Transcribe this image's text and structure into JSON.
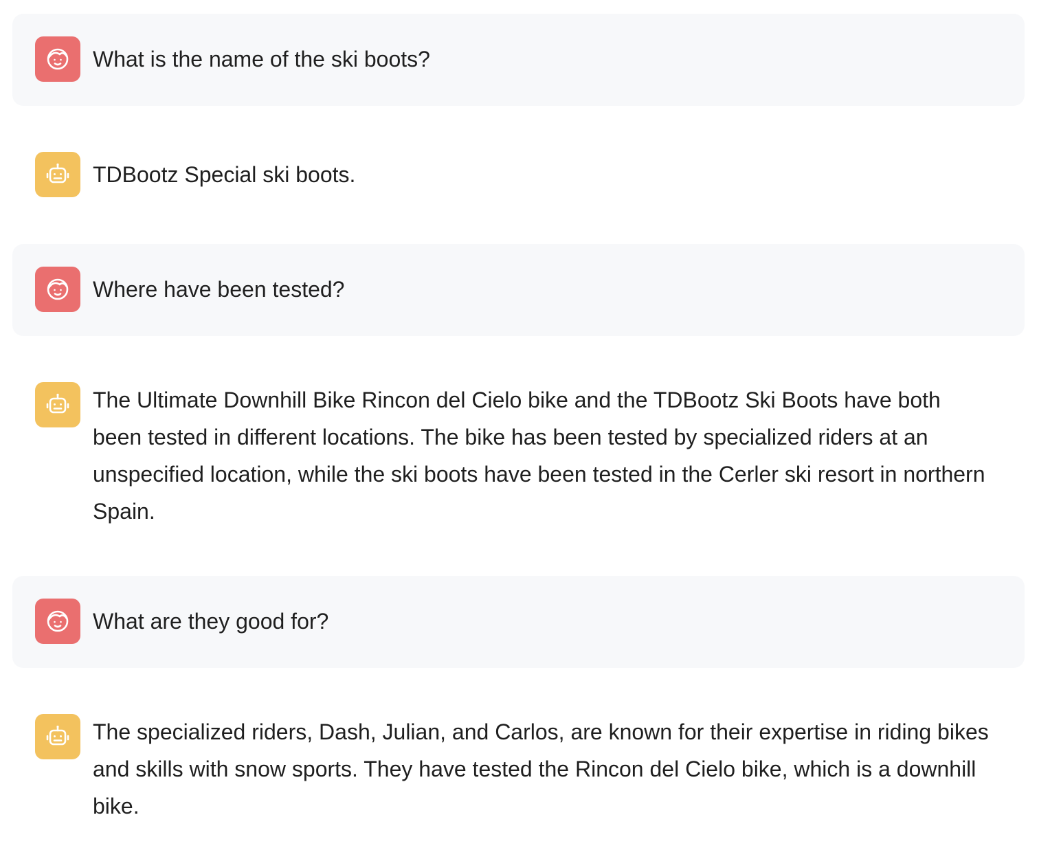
{
  "conversation": {
    "messages": [
      {
        "role": "user",
        "avatar_icon": "user-face-icon",
        "text": "What is the name of the ski boots?"
      },
      {
        "role": "assistant",
        "avatar_icon": "robot-icon",
        "text": "TDBootz Special ski boots."
      },
      {
        "role": "user",
        "avatar_icon": "user-face-icon",
        "text": "Where have been tested?"
      },
      {
        "role": "assistant",
        "avatar_icon": "robot-icon",
        "text": "The Ultimate Downhill Bike Rincon del Cielo bike and the TDBootz Ski Boots have both been tested in different locations. The bike has been tested by specialized riders at an unspecified location, while the ski boots have been tested in the Cerler ski resort in northern Spain."
      },
      {
        "role": "user",
        "avatar_icon": "user-face-icon",
        "text": "What are they good for?"
      },
      {
        "role": "assistant",
        "avatar_icon": "robot-icon",
        "text": "The specialized riders, Dash, Julian, and Carlos, are known for their expertise in riding bikes and skills with snow sports. They have tested the Rincon del Cielo bike, which is a downhill bike."
      }
    ]
  },
  "colors": {
    "user_avatar": "#ea6f6f",
    "assistant_avatar": "#f3c25e",
    "user_bubble": "#f7f8fa"
  }
}
